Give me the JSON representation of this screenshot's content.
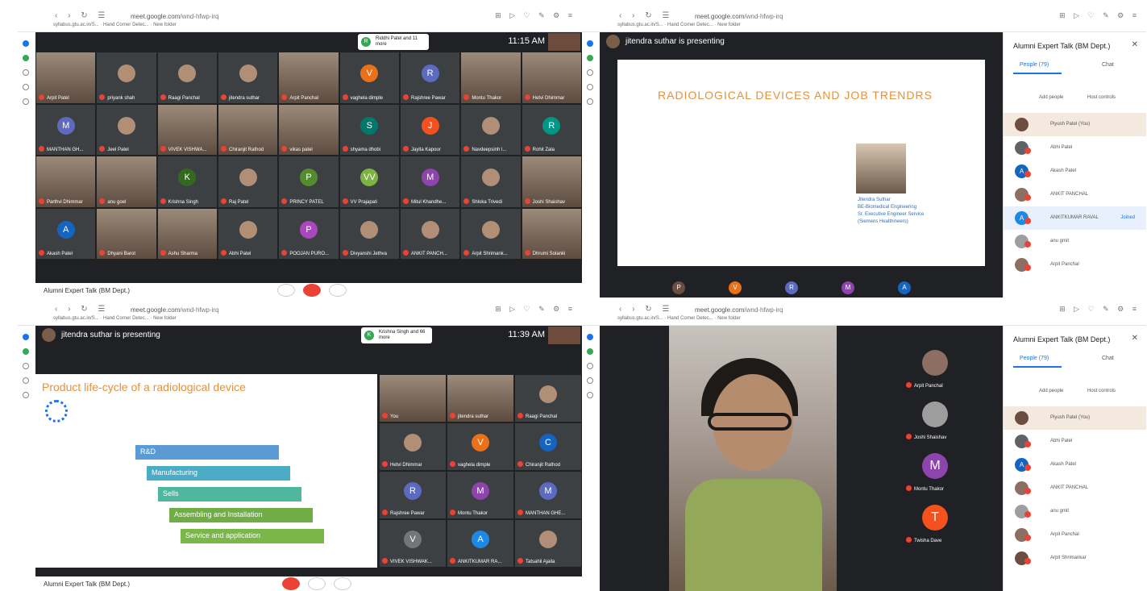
{
  "browser": {
    "url_domain": "meet.google.com",
    "url_path": "/wnd-hfwp-irq",
    "bookmarks": [
      "syllabus.gtu.ac.in/S...",
      "Hand Corner Detec...",
      "New folder"
    ]
  },
  "meeting_title": "Alumni Expert Talk (BM Dept.)",
  "q1": {
    "pill_initial": "R",
    "pill_text": "Riddhi Patel and 11 more",
    "time": "11:15 AM",
    "self_label": "You",
    "tiles": [
      {
        "name": "Arpit Patel",
        "kind": "video"
      },
      {
        "name": "priyank shah",
        "kind": "photo"
      },
      {
        "name": "Raagi Panchal",
        "kind": "photo"
      },
      {
        "name": "jitendra suthar",
        "kind": "photo"
      },
      {
        "name": "Arpit Panchal",
        "kind": "video"
      },
      {
        "name": "vaghela dimple",
        "kind": "circle",
        "initial": "V",
        "color": "#e8711a"
      },
      {
        "name": "Rajshree Pawar",
        "kind": "circle",
        "initial": "R",
        "color": "#5c6bc0"
      },
      {
        "name": "Montu Thakor",
        "kind": "video"
      },
      {
        "name": "Hetvi Dhimmar",
        "kind": "video"
      },
      {
        "name": "MANTHAN GH...",
        "kind": "circle",
        "initial": "M",
        "color": "#5c6bc0"
      },
      {
        "name": "Jeel Patel",
        "kind": "photo"
      },
      {
        "name": "VIVEK VISHWA...",
        "kind": "video"
      },
      {
        "name": "Chiranjit Rathod",
        "kind": "video"
      },
      {
        "name": "vikas patel",
        "kind": "video"
      },
      {
        "name": "shyama dhobi",
        "kind": "circle",
        "initial": "S",
        "color": "#00796b"
      },
      {
        "name": "Jayita Kapoor",
        "kind": "circle",
        "initial": "J",
        "color": "#f4511e"
      },
      {
        "name": "Navdeepsinh l...",
        "kind": "photo"
      },
      {
        "name": "Rohit Zala",
        "kind": "circle",
        "initial": "R",
        "color": "#009688"
      },
      {
        "name": "Parthvi Dhimmar",
        "kind": "video"
      },
      {
        "name": "anu goel",
        "kind": "video"
      },
      {
        "name": "Krishna Singh",
        "kind": "circle",
        "initial": "K",
        "color": "#33691e"
      },
      {
        "name": "Raj Patel",
        "kind": "photo"
      },
      {
        "name": "PRINCY PATEL",
        "kind": "circle",
        "initial": "P",
        "color": "#558b2f"
      },
      {
        "name": "VV Prajapati",
        "kind": "circle",
        "initial": "VV",
        "color": "#7cb342"
      },
      {
        "name": "Mitul Khandhe...",
        "kind": "circle",
        "initial": "M",
        "color": "#8e44ad"
      },
      {
        "name": "Shloka Trivedi",
        "kind": "photo"
      },
      {
        "name": "Joshi Shaishav",
        "kind": "video"
      },
      {
        "name": "Akash Patel",
        "kind": "circle",
        "initial": "A",
        "color": "#1565c0"
      },
      {
        "name": "Dhyani Barot",
        "kind": "video"
      },
      {
        "name": "Ashu Sharma",
        "kind": "video"
      },
      {
        "name": "Abhi Patel",
        "kind": "photo"
      },
      {
        "name": "POOJAN PURO...",
        "kind": "circle",
        "initial": "P",
        "color": "#ab47bc"
      },
      {
        "name": "Divyanshi Jethva",
        "kind": "photo"
      },
      {
        "name": "ANKIT PANCH...",
        "kind": "photo"
      },
      {
        "name": "Arpit Shrimank...",
        "kind": "photo"
      },
      {
        "name": "Dhrumi Solanki",
        "kind": "video"
      }
    ],
    "controls_title": "Alumni Expert Talk (BM Dept.)"
  },
  "q2": {
    "presenter": "jitendra suthar is presenting",
    "slide_title": "RADIOLOGICAL DEVICES AND JOB TRENDRS",
    "speaker_lines": [
      "Jitendra Suthar",
      "BE-Biomedical Engineering",
      "Sr. Executive Engineer Service",
      "(Siemens Healthineers)"
    ],
    "strip": [
      {
        "initial": "P",
        "color": "#6d4c41"
      },
      {
        "initial": "V",
        "color": "#e8711a"
      },
      {
        "initial": "R",
        "color": "#5c6bc0"
      },
      {
        "initial": "M",
        "color": "#8e44ad"
      },
      {
        "initial": "A",
        "color": "#1565c0"
      }
    ]
  },
  "people_panel": {
    "people_tab": "People (79)",
    "chat_tab": "Chat",
    "add_people": "Add people",
    "host_controls": "Host controls",
    "close": "✕",
    "joined": "Joined"
  },
  "q2_people": [
    {
      "name": "Piyush Patel (You)",
      "color": "#6d4c41",
      "me": true
    },
    {
      "name": "Abhi Patel",
      "color": "#5f6368"
    },
    {
      "name": "Akash Patel",
      "initial": "A",
      "color": "#1565c0"
    },
    {
      "name": "ANKIT PANCHAL",
      "color": "#8d6e63"
    },
    {
      "name": "ANKITKUMAR RAVAL",
      "initial": "A",
      "color": "#1e88e5",
      "hl": true,
      "joined": true
    },
    {
      "name": "anu gmit",
      "color": "#9e9e9e"
    },
    {
      "name": "Arpit Panchal",
      "color": "#8d6e63"
    }
  ],
  "q3": {
    "presenter": "jitendra suthar is presenting",
    "pill_initial": "K",
    "pill_text": "Krishna Singh and 66 more",
    "time": "11:39 AM",
    "self_label": "You",
    "slide_title": "Product life-cycle of a radiological device",
    "steps": [
      {
        "label": "R&D",
        "color": "#5b9bd5"
      },
      {
        "label": "Manufacturing",
        "color": "#4bacc6"
      },
      {
        "label": "Sells",
        "color": "#4fb6a0"
      },
      {
        "label": "Assembling and Installation",
        "color": "#70ad47"
      },
      {
        "label": "Service and application",
        "color": "#7ab648"
      }
    ],
    "tiles": [
      {
        "name": "You",
        "kind": "video"
      },
      {
        "name": "jitendra suthar",
        "kind": "video"
      },
      {
        "name": "Raagi Panchal",
        "kind": "photo"
      },
      {
        "name": "Hetvi Dhimmar",
        "kind": "photo"
      },
      {
        "name": "vaghela dimple",
        "kind": "circle",
        "initial": "V",
        "color": "#e8711a"
      },
      {
        "name": "Chiranjit Rathod",
        "kind": "circle",
        "initial": "C",
        "color": "#1565c0"
      },
      {
        "name": "Rajshree Pawar",
        "kind": "circle",
        "initial": "R",
        "color": "#5c6bc0"
      },
      {
        "name": "Montu Thakor",
        "kind": "circle",
        "initial": "M",
        "color": "#8e44ad"
      },
      {
        "name": "MANTHAN GHE...",
        "kind": "circle",
        "initial": "M",
        "color": "#5c6bc0"
      },
      {
        "name": "VIVEK VISHWAK...",
        "kind": "circle",
        "initial": "V",
        "color": "#757575"
      },
      {
        "name": "ANKITKUMAR RA...",
        "kind": "circle",
        "initial": "A",
        "color": "#1e88e5"
      },
      {
        "name": "Tatsahil Ajaila",
        "kind": "photo"
      }
    ],
    "controls_title": "Alumni Expert Talk (BM Dept.)"
  },
  "q4": {
    "side_tiles": [
      {
        "name": "Arpit Panchal",
        "kind": "photo",
        "color": "#8d6e63"
      },
      {
        "name": "Joshi Shaishav",
        "kind": "photo",
        "color": "#9e9e9e"
      },
      {
        "name": "Montu Thakor",
        "initial": "M",
        "color": "#8e44ad"
      },
      {
        "name": "Twisha Dave",
        "initial": "T",
        "color": "#f4511e"
      }
    ]
  },
  "q4_people": [
    {
      "name": "Piyush Patel (You)",
      "color": "#6d4c41",
      "me": true
    },
    {
      "name": "Abhi Patel",
      "color": "#5f6368"
    },
    {
      "name": "Akash Patel",
      "initial": "A",
      "color": "#1565c0"
    },
    {
      "name": "ANKIT PANCHAL",
      "color": "#8d6e63"
    },
    {
      "name": "anu gmit",
      "color": "#9e9e9e"
    },
    {
      "name": "Arpit Panchal",
      "color": "#8d6e63"
    },
    {
      "name": "Arpit Shrimankar",
      "color": "#6d4c41"
    }
  ]
}
